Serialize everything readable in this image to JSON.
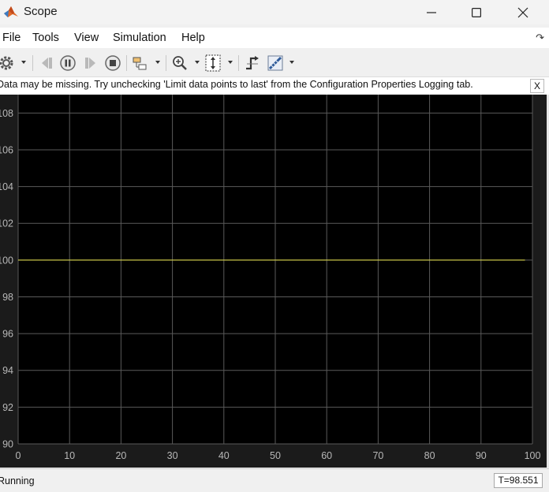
{
  "window": {
    "title": "Scope",
    "controls": [
      "minimize",
      "maximize",
      "close"
    ]
  },
  "menu": {
    "items": [
      "File",
      "Tools",
      "View",
      "Simulation",
      "Help"
    ]
  },
  "toolbar": {
    "buttons": [
      {
        "icon": "gear-icon",
        "dropdown": true
      },
      {
        "icon": "step-back-icon",
        "enabled": false
      },
      {
        "icon": "pause-icon",
        "enabled": true
      },
      {
        "icon": "step-forward-icon",
        "enabled": false
      },
      {
        "icon": "stop-icon",
        "enabled": true
      },
      {
        "icon": "highlight-block-icon",
        "dropdown": true
      },
      {
        "icon": "zoom-in-icon",
        "dropdown": true
      },
      {
        "icon": "scale-axes-icon",
        "dropdown": true
      },
      {
        "icon": "triggers-icon"
      },
      {
        "icon": "measurements-icon",
        "dropdown": true
      }
    ]
  },
  "notice": {
    "text": "Data may be missing.  Try unchecking 'Limit data points to last' from the Configuration Properties Logging tab.",
    "close_label": "X"
  },
  "chart_data": {
    "type": "line",
    "title": "",
    "xlabel": "",
    "ylabel": "",
    "xlim": [
      0,
      100
    ],
    "ylim": [
      90,
      109
    ],
    "xticks": [
      0,
      10,
      20,
      30,
      40,
      50,
      60,
      70,
      80,
      90,
      100
    ],
    "yticks": [
      90,
      92,
      94,
      96,
      98,
      100,
      102,
      104,
      106,
      108
    ],
    "grid": true,
    "background": "#000000",
    "grid_color": "#5a5a5a",
    "series": [
      {
        "color": "#e8e34a",
        "x": [
          0,
          98.551
        ],
        "y": [
          100,
          100
        ]
      }
    ]
  },
  "status": {
    "state": "Running",
    "time": "T=98.551"
  }
}
